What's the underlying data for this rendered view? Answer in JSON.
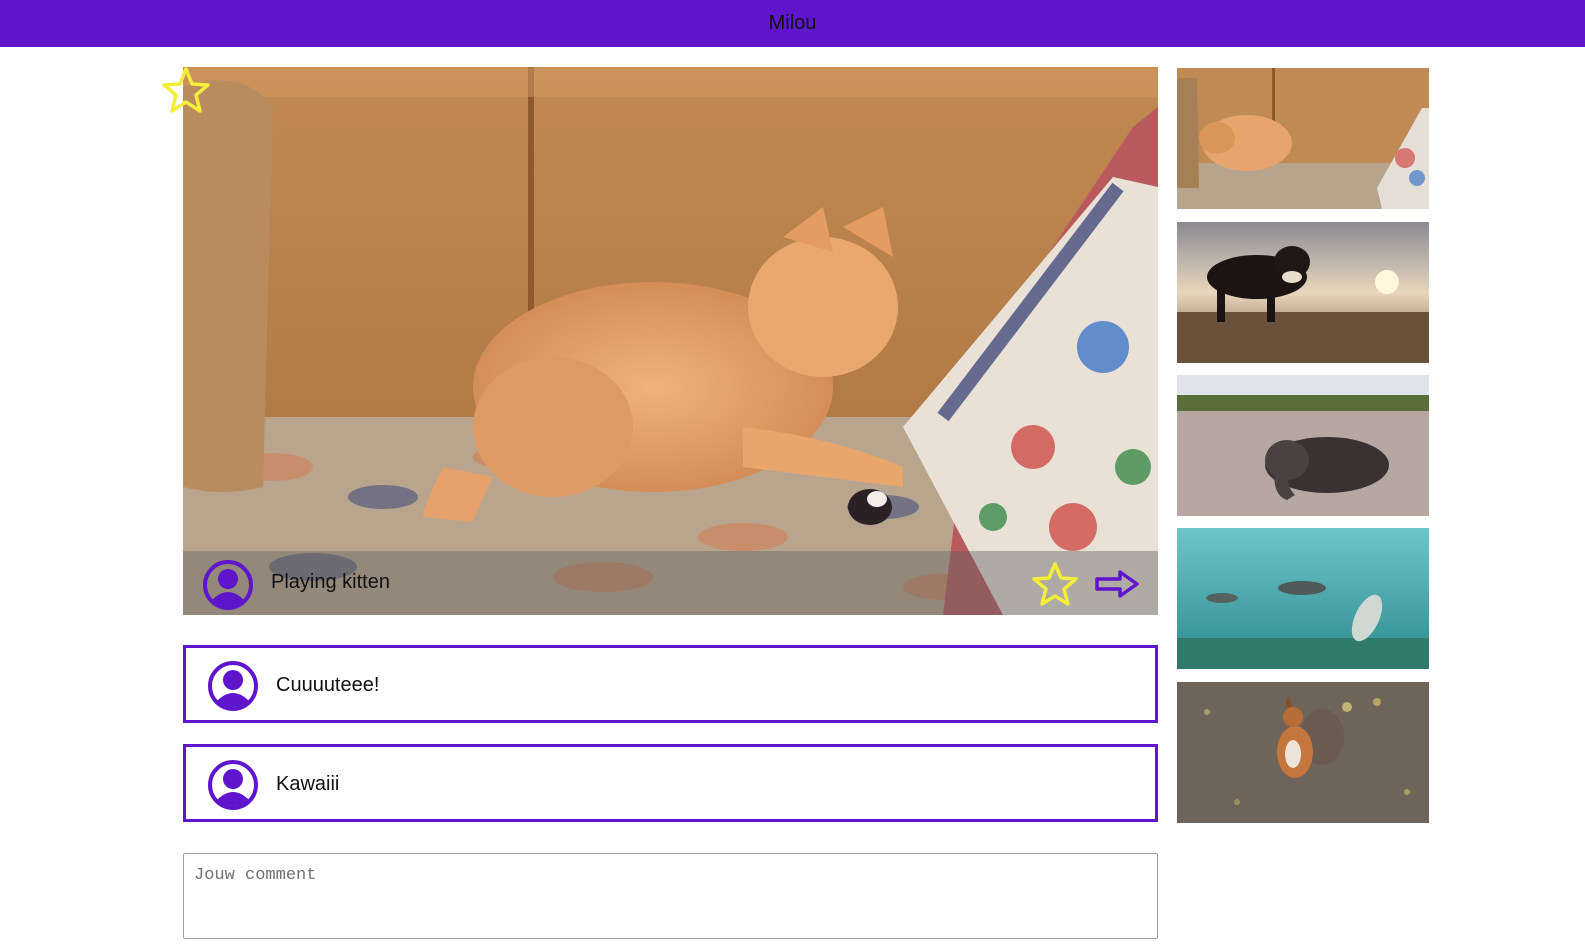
{
  "app": {
    "title": "Milou",
    "accent_color": "#5e15cc",
    "star_color": "#f4ee3a"
  },
  "video": {
    "title": "Playing kitten",
    "favorite_icon": "star-outline-icon",
    "next_icon": "arrow-right-icon",
    "avatar_icon": "user-avatar-icon"
  },
  "comments": [
    {
      "text": "Cuuuuteee!",
      "avatar_icon": "user-avatar-icon"
    },
    {
      "text": "Kawaiii",
      "avatar_icon": "user-avatar-icon"
    }
  ],
  "comment_input": {
    "placeholder": "Jouw comment",
    "value": ""
  },
  "sidebar": {
    "thumbnails": [
      {
        "subject": "kitten-thumbnail"
      },
      {
        "subject": "puppy-thumbnail"
      },
      {
        "subject": "elephant-thumbnail"
      },
      {
        "subject": "seals-thumbnail"
      },
      {
        "subject": "squirrel-thumbnail"
      }
    ]
  }
}
